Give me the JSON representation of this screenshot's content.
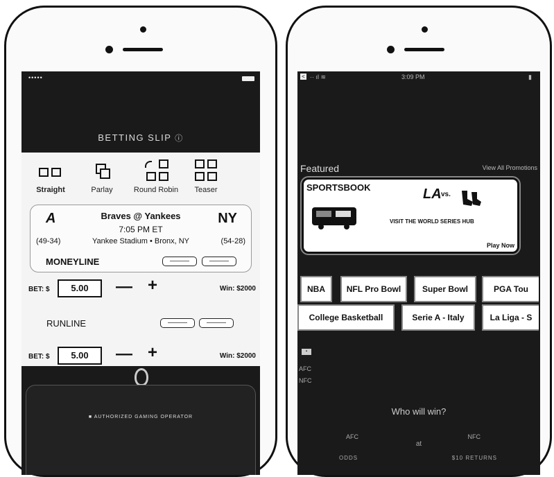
{
  "left_phone": {
    "status": {
      "dots": "•••••"
    },
    "slip_title": "BETTING SLIP",
    "bet_types": [
      {
        "label": "Straight",
        "icon": "two-squares-icon"
      },
      {
        "label": "Parlay",
        "icon": "stacked-squares-icon"
      },
      {
        "label": "Round Robin",
        "icon": "round-robin-icon"
      },
      {
        "label": "Teaser",
        "icon": "four-squares-icon"
      }
    ],
    "game": {
      "matchup": "Braves @ Yankees",
      "time": "7:05 PM ET",
      "venue": "Yankee Stadium • Bronx, NY",
      "away_record": "(49-34)",
      "home_record": "(54-28)",
      "away_logo": "A",
      "home_logo": "NY"
    },
    "moneyline": "MONEYLINE",
    "runline": "RUNLINE",
    "bet_row_1": {
      "label": "BET: $",
      "amount": "5.00",
      "minus": "—",
      "plus": "+",
      "win": "Win: $2000"
    },
    "bet_row_2": {
      "label": "BET: $",
      "amount": "5.00",
      "minus": "—",
      "plus": "+",
      "win": "Win: $2000"
    },
    "operator": "AUTHORIZED GAMING OPERATOR"
  },
  "right_phone": {
    "status": {
      "back": "<",
      "time": "3:09 PM"
    },
    "featured": "Featured",
    "view_all": "View All Promotions",
    "promo": {
      "title": "SPORTSBOOK",
      "la_logo": "LA",
      "vs": "vs.",
      "visit": "VISIT THE WORLD SERIES HUB",
      "play_now": "Play Now"
    },
    "chips_row1": [
      "NBA",
      "NFL Pro Bowl",
      "Super Bowl",
      "PGA Tou"
    ],
    "chips_row2": [
      "College Basketball",
      "Serie A - Italy",
      "La Liga - S"
    ],
    "afc": "AFC",
    "nfc": "NFC",
    "who_wins": "Who will win?",
    "ww_afc": "AFC",
    "ww_at": "at",
    "ww_nfc": "NFC",
    "odds": "ODDS",
    "returns": "$10 RETURNS"
  }
}
